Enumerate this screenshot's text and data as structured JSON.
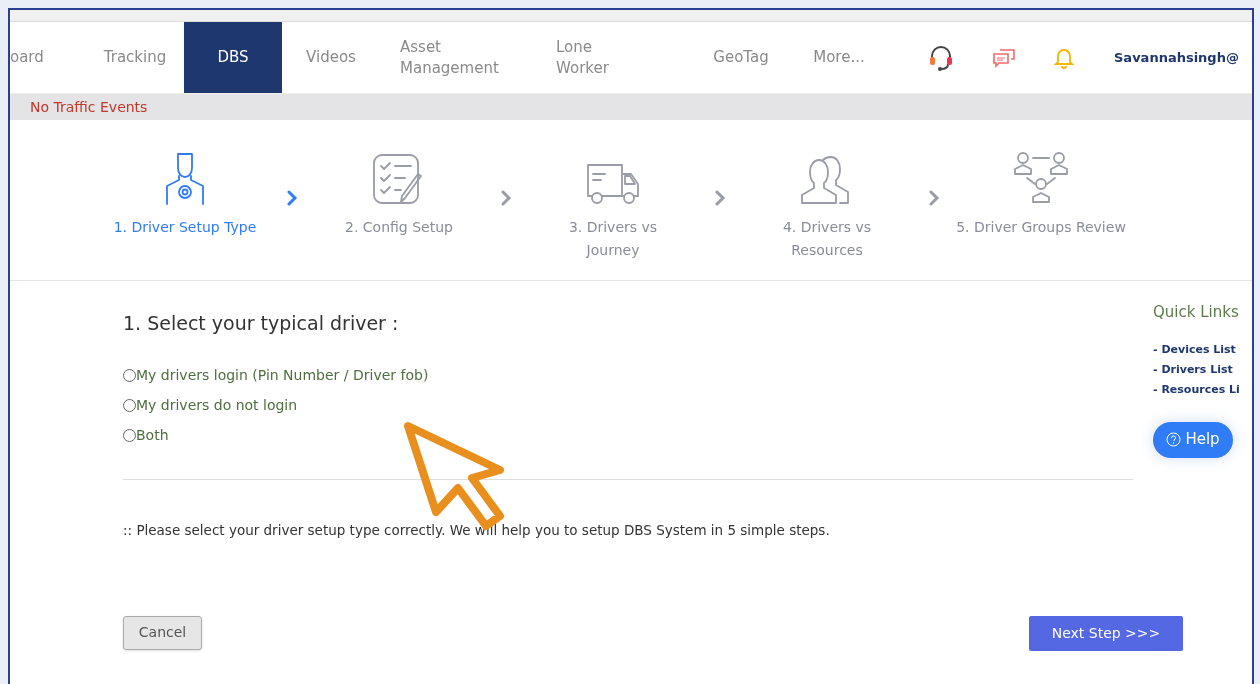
{
  "nav": {
    "tabs": [
      {
        "label": "oard",
        "selected": false
      },
      {
        "label": "Tracking",
        "selected": false
      },
      {
        "label": "DBS",
        "selected": true
      },
      {
        "label": "Videos",
        "selected": false
      },
      {
        "label": "Asset Management",
        "selected": false
      },
      {
        "label": "Lone Worker",
        "selected": false
      },
      {
        "label": "GeoTag",
        "selected": false
      },
      {
        "label": "More...",
        "selected": false
      }
    ],
    "user": "Savannahsingh@"
  },
  "traffic": "No Traffic Events",
  "steps": [
    {
      "kind": "driver",
      "label": "1. Driver Setup Type",
      "selected": true
    },
    {
      "kind": "config",
      "label": "2. Config Setup",
      "selected": false
    },
    {
      "kind": "truck",
      "label": "3. Drivers vs Journey",
      "selected": false
    },
    {
      "kind": "people",
      "label": "4. Drivers vs Resources",
      "selected": false
    },
    {
      "kind": "groups",
      "label": "5. Driver Groups Review",
      "selected": false
    }
  ],
  "question": "1. Select your typical driver :",
  "options": [
    {
      "label": "My drivers login (Pin Number / Driver fob)",
      "selected": false
    },
    {
      "label": "My drivers do not login",
      "selected": false
    },
    {
      "label": "Both",
      "selected": false
    }
  ],
  "note": ":: Please select your driver setup type correctly. We will help you to setup DBS System in 5 simple steps.",
  "quick_links": {
    "title": "Quick Links",
    "links": [
      "- Devices List",
      "- Drivers List",
      "- Resources Li"
    ]
  },
  "help": "Help",
  "buttons": {
    "cancel": "Cancel",
    "next": "Next Step >>>"
  }
}
